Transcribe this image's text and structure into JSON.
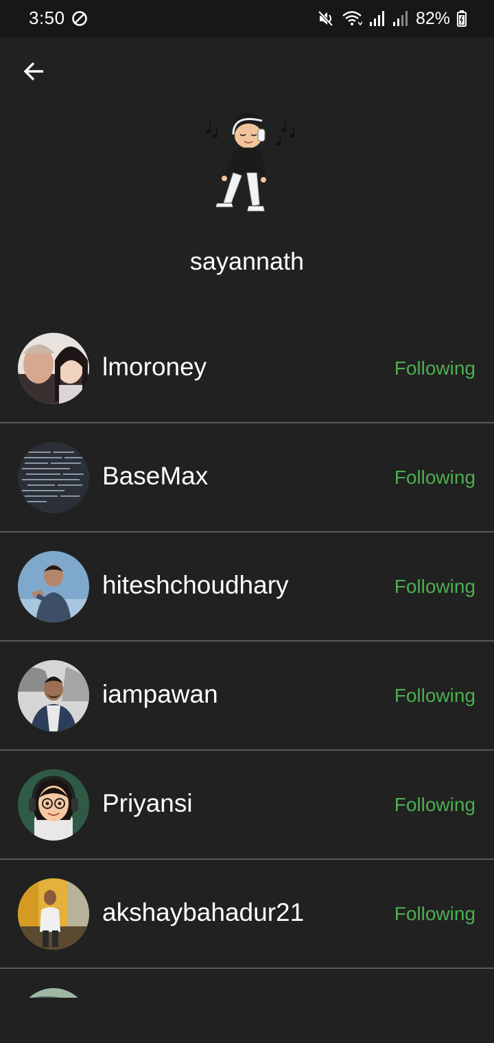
{
  "status_bar": {
    "time": "3:50",
    "battery_percent": "82%",
    "icons": [
      "dnd-icon",
      "mute-icon",
      "wifi-icon",
      "signal-icon",
      "signal-icon-2",
      "battery-icon"
    ]
  },
  "header": {
    "back_icon": "arrow-left-icon"
  },
  "profile": {
    "username": "sayannath"
  },
  "following": [
    {
      "username": "lmoroney",
      "status": "Following"
    },
    {
      "username": "BaseMax",
      "status": "Following"
    },
    {
      "username": "hiteshchoudhary",
      "status": "Following"
    },
    {
      "username": "iampawan",
      "status": "Following"
    },
    {
      "username": "Priyansi",
      "status": "Following"
    },
    {
      "username": "akshaybahadur21",
      "status": "Following"
    }
  ],
  "colors": {
    "background": "#212121",
    "status_bar": "#171717",
    "following_text": "#4caf50",
    "divider": "#5a5a5a"
  }
}
